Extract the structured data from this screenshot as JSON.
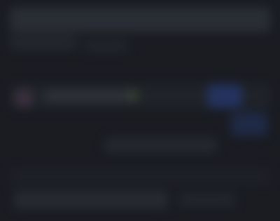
{
  "screen": {
    "note_state": "blurred",
    "accent_color": "#24335e",
    "secondary_accent_color": "#3a2f3e",
    "badge_color": "#374031"
  }
}
